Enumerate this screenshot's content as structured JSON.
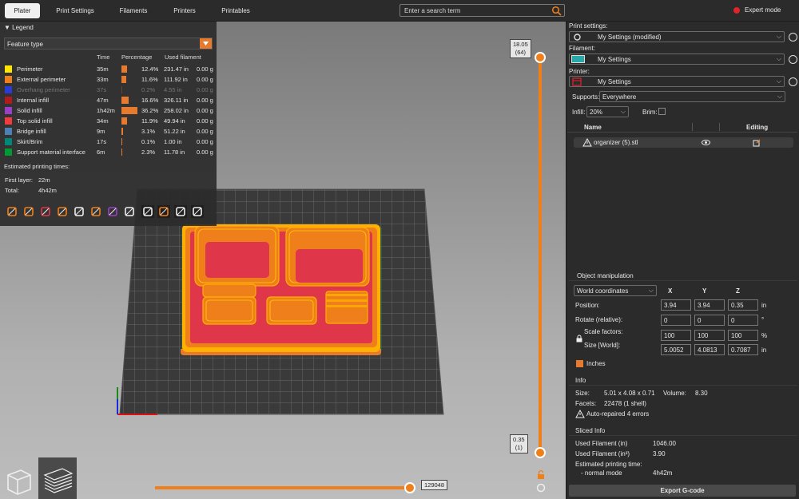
{
  "tabs": [
    {
      "label": "Plater",
      "active": true
    },
    {
      "label": "Print Settings"
    },
    {
      "label": "Filaments"
    },
    {
      "label": "Printers"
    },
    {
      "label": "Printables"
    }
  ],
  "search": {
    "placeholder": "Enter a search term"
  },
  "mode": {
    "label": "Expert mode",
    "color": "#e0242c"
  },
  "legend": {
    "title": "Legend",
    "view_type": "Feature type",
    "columns": {
      "time": "Time",
      "percentage": "Percentage",
      "used": "Used filament"
    },
    "rows": [
      {
        "name": "Perimeter",
        "time": "35m",
        "pct": "12.4%",
        "len": "231.47 in",
        "g": "0.00 g",
        "color": "#ffe600",
        "frac": 0.124
      },
      {
        "name": "External perimeter",
        "time": "33m",
        "pct": "11.6%",
        "len": "111.92 in",
        "g": "0.00 g",
        "color": "#ef7f1a",
        "frac": 0.116
      },
      {
        "name": "Overhang perimeter",
        "time": "37s",
        "pct": "0.2%",
        "len": "4.55 in",
        "g": "0.00 g",
        "color": "#2d3bd6",
        "frac": 0.002,
        "dim": true
      },
      {
        "name": "Internal infill",
        "time": "47m",
        "pct": "16.6%",
        "len": "326.11 in",
        "g": "0.00 g",
        "color": "#b01c1c",
        "frac": 0.166
      },
      {
        "name": "Solid infill",
        "time": "1h42m",
        "pct": "36.2%",
        "len": "258.02 in",
        "g": "0.00 g",
        "color": "#9b3fc8",
        "frac": 0.362
      },
      {
        "name": "Top solid infill",
        "time": "34m",
        "pct": "11.9%",
        "len": "49.94 in",
        "g": "0.00 g",
        "color": "#f03c3c",
        "frac": 0.119
      },
      {
        "name": "Bridge infill",
        "time": "9m",
        "pct": "3.1%",
        "len": "51.22 in",
        "g": "0.00 g",
        "color": "#4d80b3",
        "frac": 0.031
      },
      {
        "name": "Skirt/Brim",
        "time": "17s",
        "pct": "0.1%",
        "len": "1.00 in",
        "g": "0.00 g",
        "color": "#00877a",
        "frac": 0.001
      },
      {
        "name": "Support material interface",
        "time": "6m",
        "pct": "2.3%",
        "len": "11.78 in",
        "g": "0.00 g",
        "color": "#009933",
        "frac": 0.023
      }
    ],
    "estimated_title": "Estimated printing times:",
    "first_layer_label": "First layer:",
    "first_layer": "22m",
    "total_label": "Total:",
    "total": "4h42m"
  },
  "layer_slider": {
    "top": "18.05",
    "top_layer": "(64)",
    "bottom": "0.35",
    "bottom_layer": "(1)",
    "upper_fraction": 1.0,
    "lower_fraction": 0.0
  },
  "move_slider": {
    "value": "129048",
    "fraction": 1.0
  },
  "right": {
    "print_settings_label": "Print settings:",
    "print_settings_value": "My Settings (modified)",
    "filament_label": "Filament:",
    "filament_value": "My Settings",
    "filament_color": "#29a8a8",
    "printer_label": "Printer:",
    "printer_value": "My Settings",
    "supports_label": "Supports:",
    "supports_value": "Everywhere",
    "infill_label": "Infill:",
    "infill_value": "20%",
    "brim_label": "Brim:",
    "col_name": "Name",
    "col_editing": "Editing",
    "object_name": "organizer (5).stl"
  },
  "manip": {
    "title": "Object manipulation",
    "coords": "World coordinates",
    "x": "X",
    "y": "Y",
    "z": "Z",
    "position_label": "Position:",
    "position": [
      "3.94",
      "3.94",
      "0.35"
    ],
    "rotate_label": "Rotate (relative):",
    "rotate": [
      "0",
      "0",
      "0"
    ],
    "scale_label": "Scale factors:",
    "scale": [
      "100",
      "100",
      "100"
    ],
    "size_label": "Size [World]:",
    "size": [
      "5.0052",
      "4.0813",
      "0.7087"
    ],
    "unit_in": "in",
    "unit_deg": "°",
    "unit_pct": "%",
    "inches_label": "Inches"
  },
  "info": {
    "title": "Info",
    "size_label": "Size:",
    "size": "5.01 x 4.08 x 0.71",
    "volume_label": "Volume:",
    "volume": "8.30",
    "facets_label": "Facets:",
    "facets": "22478 (1 shell)",
    "repaired": "Auto-repaired 4 errors"
  },
  "sliced": {
    "title": "Sliced Info",
    "used_in_label": "Used Filament (in)",
    "used_in": "1046.00",
    "used_in3_label": "Used Filament (in³)",
    "used_in3": "3.90",
    "est_label": "Estimated printing time:",
    "normal_label": "- normal mode",
    "normal": "4h42m"
  },
  "export_label": "Export G-code"
}
